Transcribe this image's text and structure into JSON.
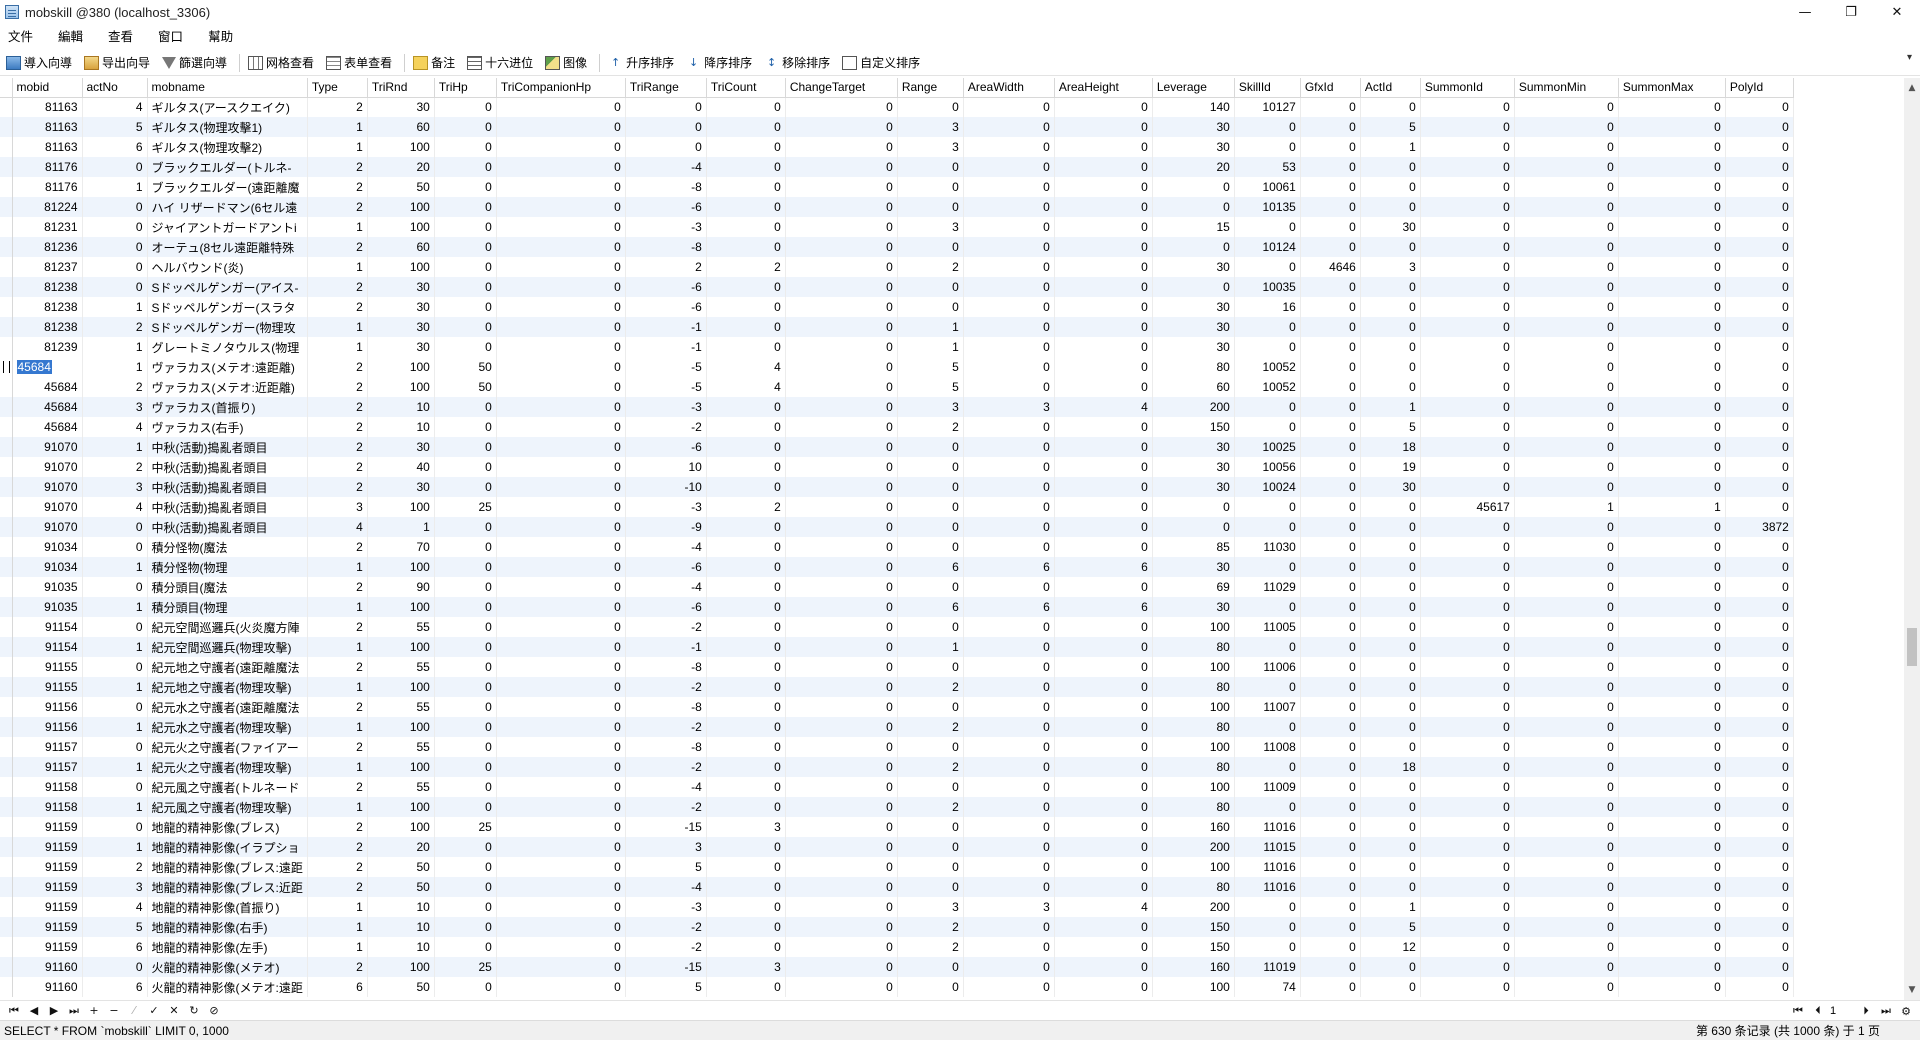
{
  "window": {
    "title": "mobskill @380 (localhost_3306)",
    "minimize": "—",
    "maximize": "❐",
    "close": "✕"
  },
  "menu": [
    "文件",
    "編輯",
    "查看",
    "窗口",
    "幫助"
  ],
  "toolbar": {
    "import": "導入向導",
    "export": "导出向导",
    "filter": "篩選向導",
    "grid_view": "网格查看",
    "form_view": "表单查看",
    "note": "备注",
    "hex": "十六进位",
    "image": "图像",
    "sort_asc": "升序排序",
    "sort_desc": "降序排序",
    "remove_sort": "移除排序",
    "custom_sort": "自定义排序"
  },
  "columns": [
    "mobid",
    "actNo",
    "mobname",
    "Type",
    "TriRnd",
    "TriHp",
    "TriCompanionHp",
    "TriRange",
    "TriCount",
    "ChangeTarget",
    "Range",
    "AreaWidth",
    "AreaHeight",
    "Leverage",
    "SkillId",
    "GfxId",
    "ActId",
    "SummonId",
    "SummonMin",
    "SummonMax",
    "PolyId"
  ],
  "rows": [
    [
      "81163",
      "4",
      "ギルタス(アースクエイク)",
      "2",
      "30",
      "0",
      "0",
      "0",
      "0",
      "0",
      "0",
      "0",
      "0",
      "140",
      "10127",
      "0",
      "0",
      "0",
      "0",
      "0",
      "0"
    ],
    [
      "81163",
      "5",
      "ギルタス(物理攻擊1)",
      "1",
      "60",
      "0",
      "0",
      "0",
      "0",
      "0",
      "3",
      "0",
      "0",
      "30",
      "0",
      "0",
      "5",
      "0",
      "0",
      "0",
      "0"
    ],
    [
      "81163",
      "6",
      "ギルタス(物理攻擊2)",
      "1",
      "100",
      "0",
      "0",
      "0",
      "0",
      "0",
      "3",
      "0",
      "0",
      "30",
      "0",
      "0",
      "1",
      "0",
      "0",
      "0",
      "0"
    ],
    [
      "81176",
      "0",
      "ブラックエルダー(トルネ-",
      "2",
      "20",
      "0",
      "0",
      "-4",
      "0",
      "0",
      "0",
      "0",
      "0",
      "20",
      "53",
      "0",
      "0",
      "0",
      "0",
      "0",
      "0"
    ],
    [
      "81176",
      "1",
      "ブラックエルダー(遠距離魔",
      "2",
      "50",
      "0",
      "0",
      "-8",
      "0",
      "0",
      "0",
      "0",
      "0",
      "0",
      "10061",
      "0",
      "0",
      "0",
      "0",
      "0",
      "0"
    ],
    [
      "81224",
      "0",
      "ハイ リザードマン(6セル遠",
      "2",
      "100",
      "0",
      "0",
      "-6",
      "0",
      "0",
      "0",
      "0",
      "0",
      "0",
      "10135",
      "0",
      "0",
      "0",
      "0",
      "0",
      "0"
    ],
    [
      "81231",
      "0",
      "ジャイアントガードアントi",
      "1",
      "100",
      "0",
      "0",
      "-3",
      "0",
      "0",
      "3",
      "0",
      "0",
      "15",
      "0",
      "0",
      "30",
      "0",
      "0",
      "0",
      "0"
    ],
    [
      "81236",
      "0",
      "オーテュ(8セル遠距離特殊",
      "2",
      "60",
      "0",
      "0",
      "-8",
      "0",
      "0",
      "0",
      "0",
      "0",
      "0",
      "10124",
      "0",
      "0",
      "0",
      "0",
      "0",
      "0"
    ],
    [
      "81237",
      "0",
      "ヘルバウンド(炎)",
      "1",
      "100",
      "0",
      "0",
      "2",
      "2",
      "0",
      "2",
      "0",
      "0",
      "30",
      "0",
      "4646",
      "3",
      "0",
      "0",
      "0",
      "0"
    ],
    [
      "81238",
      "0",
      "Sドッペルゲンガー(アイス-",
      "2",
      "30",
      "0",
      "0",
      "-6",
      "0",
      "0",
      "0",
      "0",
      "0",
      "0",
      "10035",
      "0",
      "0",
      "0",
      "0",
      "0",
      "0"
    ],
    [
      "81238",
      "1",
      "Sドッペルゲンガー(スラタ",
      "2",
      "30",
      "0",
      "0",
      "-6",
      "0",
      "0",
      "0",
      "0",
      "0",
      "30",
      "16",
      "0",
      "0",
      "0",
      "0",
      "0",
      "0"
    ],
    [
      "81238",
      "2",
      "Sドッペルゲンガー(物理攻",
      "1",
      "30",
      "0",
      "0",
      "-1",
      "0",
      "0",
      "1",
      "0",
      "0",
      "30",
      "0",
      "0",
      "0",
      "0",
      "0",
      "0",
      "0"
    ],
    [
      "81239",
      "1",
      "グレートミノタウルス(物理",
      "1",
      "30",
      "0",
      "0",
      "-1",
      "0",
      "0",
      "1",
      "0",
      "0",
      "30",
      "0",
      "0",
      "0",
      "0",
      "0",
      "0",
      "0"
    ],
    [
      "45684",
      "1",
      "ヴァラカス(メテオ:遠距離)",
      "2",
      "100",
      "50",
      "0",
      "-5",
      "4",
      "0",
      "5",
      "0",
      "0",
      "80",
      "10052",
      "0",
      "0",
      "0",
      "0",
      "0",
      "0"
    ],
    [
      "45684",
      "2",
      "ヴァラカス(メテオ:近距離)",
      "2",
      "100",
      "50",
      "0",
      "-5",
      "4",
      "0",
      "5",
      "0",
      "0",
      "60",
      "10052",
      "0",
      "0",
      "0",
      "0",
      "0",
      "0"
    ],
    [
      "45684",
      "3",
      "ヴァラカス(首振り)",
      "2",
      "10",
      "0",
      "0",
      "-3",
      "0",
      "0",
      "3",
      "3",
      "4",
      "200",
      "0",
      "0",
      "1",
      "0",
      "0",
      "0",
      "0"
    ],
    [
      "45684",
      "4",
      "ヴァラカス(右手)",
      "2",
      "10",
      "0",
      "0",
      "-2",
      "0",
      "0",
      "2",
      "0",
      "0",
      "150",
      "0",
      "0",
      "5",
      "0",
      "0",
      "0",
      "0"
    ],
    [
      "91070",
      "1",
      "中秋(活動)搗亂者頭目",
      "2",
      "30",
      "0",
      "0",
      "-6",
      "0",
      "0",
      "0",
      "0",
      "0",
      "30",
      "10025",
      "0",
      "18",
      "0",
      "0",
      "0",
      "0"
    ],
    [
      "91070",
      "2",
      "中秋(活動)搗亂者頭目",
      "2",
      "40",
      "0",
      "0",
      "10",
      "0",
      "0",
      "0",
      "0",
      "0",
      "30",
      "10056",
      "0",
      "19",
      "0",
      "0",
      "0",
      "0"
    ],
    [
      "91070",
      "3",
      "中秋(活動)搗亂者頭目",
      "2",
      "30",
      "0",
      "0",
      "-10",
      "0",
      "0",
      "0",
      "0",
      "0",
      "30",
      "10024",
      "0",
      "30",
      "0",
      "0",
      "0",
      "0"
    ],
    [
      "91070",
      "4",
      "中秋(活動)搗亂者頭目",
      "3",
      "100",
      "25",
      "0",
      "-3",
      "2",
      "0",
      "0",
      "0",
      "0",
      "0",
      "0",
      "0",
      "0",
      "45617",
      "1",
      "1",
      "0"
    ],
    [
      "91070",
      "0",
      "中秋(活動)搗亂者頭目",
      "4",
      "1",
      "0",
      "0",
      "-9",
      "0",
      "0",
      "0",
      "0",
      "0",
      "0",
      "0",
      "0",
      "0",
      "0",
      "0",
      "0",
      "3872"
    ],
    [
      "91034",
      "0",
      "積分怪物(魔法",
      "2",
      "70",
      "0",
      "0",
      "-4",
      "0",
      "0",
      "0",
      "0",
      "0",
      "85",
      "11030",
      "0",
      "0",
      "0",
      "0",
      "0",
      "0"
    ],
    [
      "91034",
      "1",
      "積分怪物(物理",
      "1",
      "100",
      "0",
      "0",
      "-6",
      "0",
      "0",
      "6",
      "6",
      "6",
      "30",
      "0",
      "0",
      "0",
      "0",
      "0",
      "0",
      "0"
    ],
    [
      "91035",
      "0",
      "積分頭目(魔法",
      "2",
      "90",
      "0",
      "0",
      "-4",
      "0",
      "0",
      "0",
      "0",
      "0",
      "69",
      "11029",
      "0",
      "0",
      "0",
      "0",
      "0",
      "0"
    ],
    [
      "91035",
      "1",
      "積分頭目(物理",
      "1",
      "100",
      "0",
      "0",
      "-6",
      "0",
      "0",
      "6",
      "6",
      "6",
      "30",
      "0",
      "0",
      "0",
      "0",
      "0",
      "0",
      "0"
    ],
    [
      "91154",
      "0",
      "紀元空間巡邏兵(火炎魔方陣",
      "2",
      "55",
      "0",
      "0",
      "-2",
      "0",
      "0",
      "0",
      "0",
      "0",
      "100",
      "11005",
      "0",
      "0",
      "0",
      "0",
      "0",
      "0"
    ],
    [
      "91154",
      "1",
      "紀元空間巡邏兵(物理攻擊)",
      "1",
      "100",
      "0",
      "0",
      "-1",
      "0",
      "0",
      "1",
      "0",
      "0",
      "80",
      "0",
      "0",
      "0",
      "0",
      "0",
      "0",
      "0"
    ],
    [
      "91155",
      "0",
      "紀元地之守護者(遠距離魔法",
      "2",
      "55",
      "0",
      "0",
      "-8",
      "0",
      "0",
      "0",
      "0",
      "0",
      "100",
      "11006",
      "0",
      "0",
      "0",
      "0",
      "0",
      "0"
    ],
    [
      "91155",
      "1",
      "紀元地之守護者(物理攻擊)",
      "1",
      "100",
      "0",
      "0",
      "-2",
      "0",
      "0",
      "2",
      "0",
      "0",
      "80",
      "0",
      "0",
      "0",
      "0",
      "0",
      "0",
      "0"
    ],
    [
      "91156",
      "0",
      "紀元水之守護者(遠距離魔法",
      "2",
      "55",
      "0",
      "0",
      "-8",
      "0",
      "0",
      "0",
      "0",
      "0",
      "100",
      "11007",
      "0",
      "0",
      "0",
      "0",
      "0",
      "0"
    ],
    [
      "91156",
      "1",
      "紀元水之守護者(物理攻擊)",
      "1",
      "100",
      "0",
      "0",
      "-2",
      "0",
      "0",
      "2",
      "0",
      "0",
      "80",
      "0",
      "0",
      "0",
      "0",
      "0",
      "0",
      "0"
    ],
    [
      "91157",
      "0",
      "紀元火之守護者(ファイアー",
      "2",
      "55",
      "0",
      "0",
      "-8",
      "0",
      "0",
      "0",
      "0",
      "0",
      "100",
      "11008",
      "0",
      "0",
      "0",
      "0",
      "0",
      "0"
    ],
    [
      "91157",
      "1",
      "紀元火之守護者(物理攻擊)",
      "1",
      "100",
      "0",
      "0",
      "-2",
      "0",
      "0",
      "2",
      "0",
      "0",
      "80",
      "0",
      "0",
      "18",
      "0",
      "0",
      "0",
      "0"
    ],
    [
      "91158",
      "0",
      "紀元風之守護者(トルネード",
      "2",
      "55",
      "0",
      "0",
      "-4",
      "0",
      "0",
      "0",
      "0",
      "0",
      "100",
      "11009",
      "0",
      "0",
      "0",
      "0",
      "0",
      "0"
    ],
    [
      "91158",
      "1",
      "紀元風之守護者(物理攻擊)",
      "1",
      "100",
      "0",
      "0",
      "-2",
      "0",
      "0",
      "2",
      "0",
      "0",
      "80",
      "0",
      "0",
      "0",
      "0",
      "0",
      "0",
      "0"
    ],
    [
      "91159",
      "0",
      "地龍的精神影像(ブレス)",
      "2",
      "100",
      "25",
      "0",
      "-15",
      "3",
      "0",
      "0",
      "0",
      "0",
      "160",
      "11016",
      "0",
      "0",
      "0",
      "0",
      "0",
      "0"
    ],
    [
      "91159",
      "1",
      "地龍的精神影像(イラプショ",
      "2",
      "20",
      "0",
      "0",
      "3",
      "0",
      "0",
      "0",
      "0",
      "0",
      "200",
      "11015",
      "0",
      "0",
      "0",
      "0",
      "0",
      "0"
    ],
    [
      "91159",
      "2",
      "地龍的精神影像(ブレス:遠距",
      "2",
      "50",
      "0",
      "0",
      "5",
      "0",
      "0",
      "0",
      "0",
      "0",
      "100",
      "11016",
      "0",
      "0",
      "0",
      "0",
      "0",
      "0"
    ],
    [
      "91159",
      "3",
      "地龍的精神影像(ブレス:近距",
      "2",
      "50",
      "0",
      "0",
      "-4",
      "0",
      "0",
      "0",
      "0",
      "0",
      "80",
      "11016",
      "0",
      "0",
      "0",
      "0",
      "0",
      "0"
    ],
    [
      "91159",
      "4",
      "地龍的精神影像(首振り)",
      "1",
      "10",
      "0",
      "0",
      "-3",
      "0",
      "0",
      "3",
      "3",
      "4",
      "200",
      "0",
      "0",
      "1",
      "0",
      "0",
      "0",
      "0"
    ],
    [
      "91159",
      "5",
      "地龍的精神影像(右手)",
      "1",
      "10",
      "0",
      "0",
      "-2",
      "0",
      "0",
      "2",
      "0",
      "0",
      "150",
      "0",
      "0",
      "5",
      "0",
      "0",
      "0",
      "0"
    ],
    [
      "91159",
      "6",
      "地龍的精神影像(左手)",
      "1",
      "10",
      "0",
      "0",
      "-2",
      "0",
      "0",
      "2",
      "0",
      "0",
      "150",
      "0",
      "0",
      "12",
      "0",
      "0",
      "0",
      "0"
    ],
    [
      "91160",
      "0",
      "火龍的精神影像(メテオ)",
      "2",
      "100",
      "25",
      "0",
      "-15",
      "3",
      "0",
      "0",
      "0",
      "0",
      "160",
      "11019",
      "0",
      "0",
      "0",
      "0",
      "0",
      "0"
    ],
    [
      "91160",
      "6",
      "火龍的精神影像(メテオ:遠距",
      "6",
      "50",
      "0",
      "0",
      "5",
      "0",
      "0",
      "0",
      "0",
      "0",
      "100",
      "74",
      "0",
      "0",
      "0",
      "0",
      "0",
      "0"
    ]
  ],
  "selected_cell": "45684",
  "navigation": {
    "first": "⏮",
    "prev": "◀",
    "next": "▶",
    "last": "⏭",
    "add": "+",
    "delete": "−",
    "edit": "⁄",
    "apply": "✓",
    "cancel": "✕",
    "refresh": "↻",
    "stop": "⊘",
    "page_first": "⏮",
    "page_prev": "⏴",
    "page_value": "1",
    "page_next": "⏵",
    "page_last": "⏭",
    "settings": "⚙"
  },
  "status": {
    "sql": "SELECT * FROM `mobskill` LIMIT 0, 1000",
    "record": "第 630 条记录 (共 1000 条) 于 1 页"
  }
}
